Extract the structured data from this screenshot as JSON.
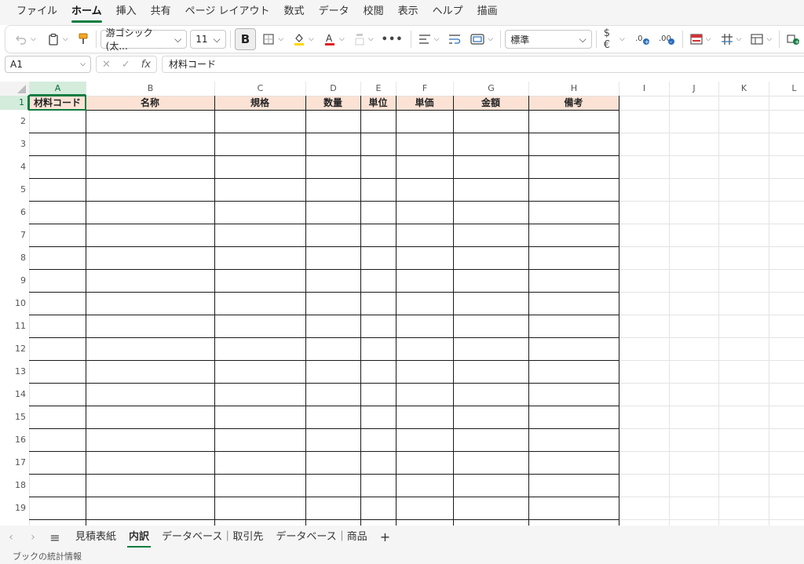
{
  "menu": {
    "tabs": [
      "ファイル",
      "ホーム",
      "挿入",
      "共有",
      "ページ レイアウト",
      "数式",
      "データ",
      "校閲",
      "表示",
      "ヘルプ",
      "描画"
    ],
    "active": "ホーム"
  },
  "ribbon": {
    "font_name": "游ゴシック (太...",
    "font_size": "11",
    "bold_label": "B",
    "number_format": "標準",
    "currency_label": "$€",
    "more_label": "•••"
  },
  "formula_bar": {
    "name_box": "A1",
    "fx_label": "fx",
    "content": "材料コード"
  },
  "sheet": {
    "columns": [
      "A",
      "B",
      "C",
      "D",
      "E",
      "F",
      "G",
      "H",
      "I",
      "J",
      "K",
      "L"
    ],
    "rows": [
      "1",
      "2",
      "3",
      "4",
      "5",
      "6",
      "7",
      "8",
      "9",
      "10",
      "11",
      "12",
      "13",
      "14",
      "15",
      "16",
      "17",
      "18",
      "19"
    ],
    "header_row": [
      "材料コード",
      "名称",
      "規格",
      "数量",
      "単位",
      "単価",
      "金額",
      "備考"
    ],
    "selected_cell": "A1",
    "header_fill": "#fbe2d5",
    "accent": "#107c41"
  },
  "sheet_tabs": {
    "tabs": [
      "見積表紙",
      "内訳",
      "データベース｜取引先",
      "データベース｜商品"
    ],
    "active": "内訳",
    "add_label": "+"
  },
  "status": {
    "text": "ブックの統計情報"
  }
}
